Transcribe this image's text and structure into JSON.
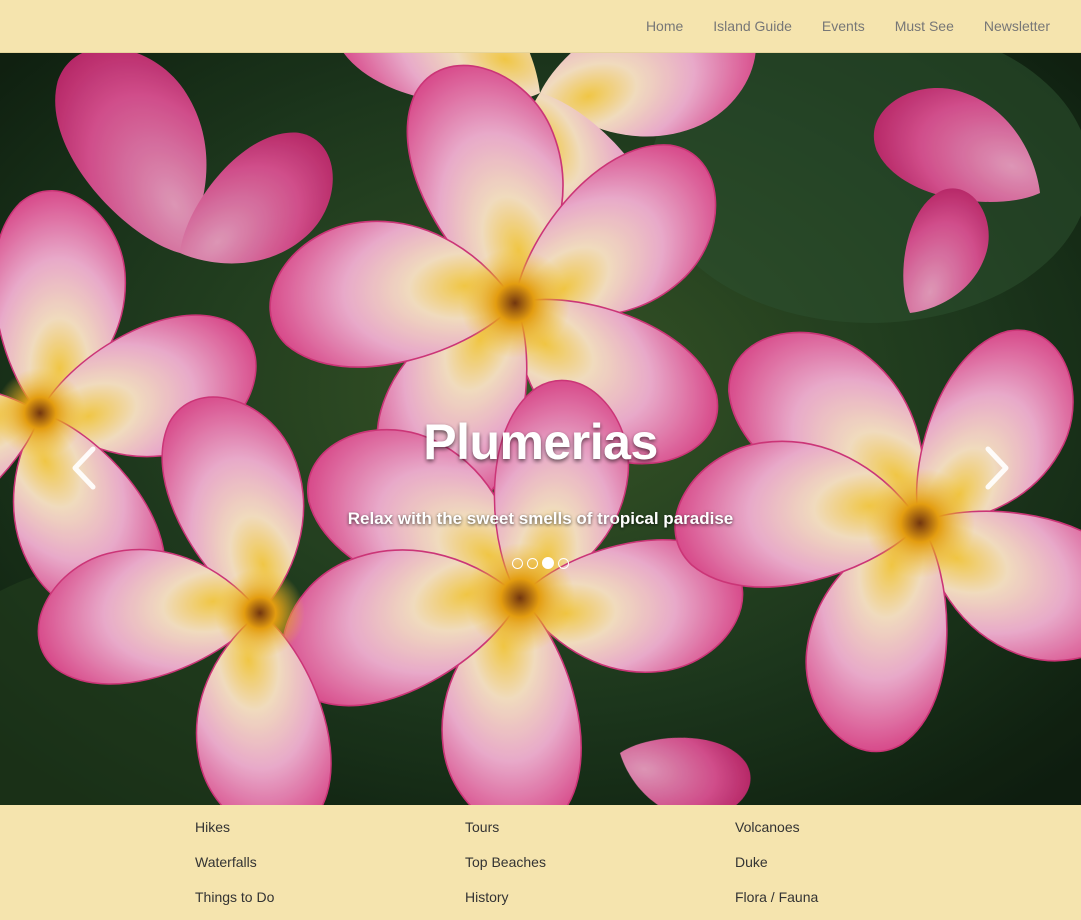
{
  "nav": {
    "items": [
      {
        "label": "Home"
      },
      {
        "label": "Island Guide"
      },
      {
        "label": "Events"
      },
      {
        "label": "Must See"
      },
      {
        "label": "Newsletter"
      }
    ]
  },
  "carousel": {
    "title": "Plumerias",
    "subtitle": "Relax with the sweet smells of tropical paradise",
    "slide_count": 4,
    "active_index": 2,
    "prev_icon": "chevron-left-icon",
    "next_icon": "chevron-right-icon"
  },
  "footer": {
    "columns": [
      {
        "links": [
          "Hikes",
          "Waterfalls",
          "Things to Do"
        ]
      },
      {
        "links": [
          "Tours",
          "Top Beaches",
          "History"
        ]
      },
      {
        "links": [
          "Volcanoes",
          "Duke",
          "Flora / Fauna"
        ]
      }
    ]
  },
  "colors": {
    "nav_background": "#f5e4ae",
    "footer_background": "#f5e4ae",
    "nav_text": "#777777"
  }
}
